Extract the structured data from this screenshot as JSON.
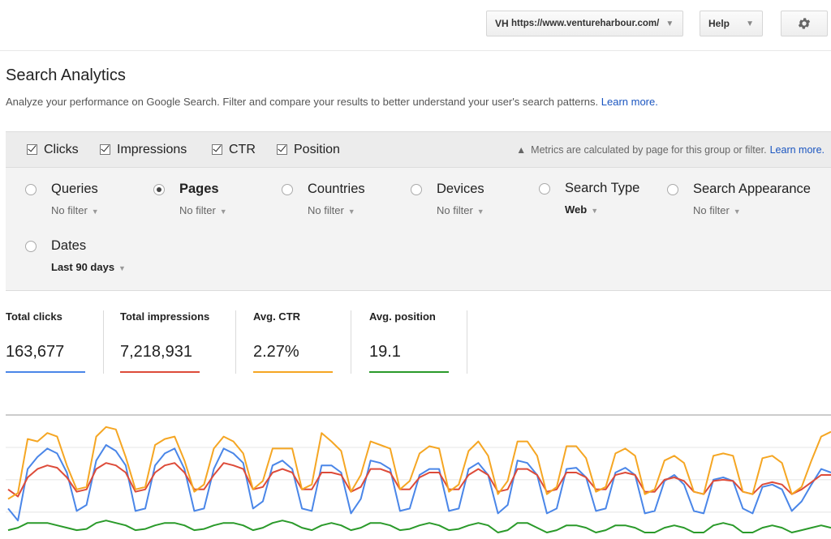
{
  "header": {
    "site_prefix": "VH",
    "site_url": "https://www.ventureharbour.com/",
    "help_label": "Help",
    "settings_icon": "gear-icon"
  },
  "page": {
    "title": "Search Analytics",
    "subtitle": "Analyze your performance on Google Search. Filter and compare your results to better understand your user's search patterns.",
    "learn_more": "Learn more."
  },
  "metrics": {
    "items": [
      {
        "label": "Clicks",
        "checked": true
      },
      {
        "label": "Impressions",
        "checked": true
      },
      {
        "label": "CTR",
        "checked": true
      },
      {
        "label": "Position",
        "checked": true
      }
    ],
    "note": "Metrics are calculated by page for this group or filter.",
    "note_link": "Learn more."
  },
  "filters": [
    {
      "name": "Queries",
      "value": "No filter",
      "selected": false
    },
    {
      "name": "Pages",
      "value": "No filter",
      "selected": true
    },
    {
      "name": "Countries",
      "value": "No filter",
      "selected": false
    },
    {
      "name": "Devices",
      "value": "No filter",
      "selected": false
    },
    {
      "name": "Search Type",
      "value": "Web",
      "selected": false
    },
    {
      "name": "Search Appearance",
      "value": "No filter",
      "selected": false
    },
    {
      "name": "Dates",
      "value": "Last 90 days",
      "selected": false
    }
  ],
  "totals": [
    {
      "label": "Total clicks",
      "value": "163,677",
      "color": "#4a86e8"
    },
    {
      "label": "Total impressions",
      "value": "7,218,931",
      "color": "#dd4b39"
    },
    {
      "label": "Avg. CTR",
      "value": "2.27%",
      "color": "#f5a623"
    },
    {
      "label": "Avg. position",
      "value": "19.1",
      "color": "#2a9a2a"
    }
  ],
  "chart_data": {
    "type": "line",
    "series": [
      {
        "color": "#4a86e8",
        "values": [
          0.22,
          0.12,
          0.55,
          0.65,
          0.72,
          0.68,
          0.52,
          0.2,
          0.25,
          0.62,
          0.75,
          0.7,
          0.58,
          0.2,
          0.22,
          0.58,
          0.68,
          0.72,
          0.55,
          0.2,
          0.22,
          0.55,
          0.72,
          0.68,
          0.6,
          0.22,
          0.28,
          0.58,
          0.62,
          0.55,
          0.22,
          0.2,
          0.58,
          0.58,
          0.52,
          0.18,
          0.3,
          0.62,
          0.6,
          0.55,
          0.2,
          0.22,
          0.5,
          0.55,
          0.55,
          0.2,
          0.22,
          0.55,
          0.6,
          0.5,
          0.18,
          0.25,
          0.62,
          0.6,
          0.5,
          0.18,
          0.22,
          0.55,
          0.56,
          0.48,
          0.2,
          0.22,
          0.52,
          0.56,
          0.5,
          0.18,
          0.2,
          0.45,
          0.5,
          0.42,
          0.2,
          0.18,
          0.46,
          0.48,
          0.45,
          0.22,
          0.18,
          0.4,
          0.42,
          0.38,
          0.2,
          0.28,
          0.42,
          0.55,
          0.52
        ]
      },
      {
        "color": "#dd4b39",
        "values": [
          0.38,
          0.32,
          0.48,
          0.55,
          0.58,
          0.56,
          0.48,
          0.36,
          0.38,
          0.55,
          0.6,
          0.58,
          0.52,
          0.36,
          0.38,
          0.52,
          0.58,
          0.6,
          0.52,
          0.38,
          0.38,
          0.5,
          0.6,
          0.58,
          0.55,
          0.38,
          0.4,
          0.52,
          0.55,
          0.52,
          0.38,
          0.38,
          0.52,
          0.52,
          0.5,
          0.36,
          0.4,
          0.55,
          0.55,
          0.52,
          0.38,
          0.38,
          0.48,
          0.52,
          0.52,
          0.38,
          0.38,
          0.5,
          0.55,
          0.5,
          0.36,
          0.38,
          0.55,
          0.55,
          0.5,
          0.36,
          0.38,
          0.52,
          0.52,
          0.48,
          0.38,
          0.38,
          0.5,
          0.52,
          0.5,
          0.36,
          0.36,
          0.46,
          0.48,
          0.45,
          0.36,
          0.34,
          0.45,
          0.46,
          0.45,
          0.36,
          0.34,
          0.42,
          0.44,
          0.42,
          0.34,
          0.38,
          0.44,
          0.5,
          0.5
        ]
      },
      {
        "color": "#f5a623",
        "values": [
          0.3,
          0.35,
          0.8,
          0.78,
          0.85,
          0.82,
          0.58,
          0.38,
          0.4,
          0.82,
          0.9,
          0.88,
          0.65,
          0.38,
          0.4,
          0.75,
          0.8,
          0.82,
          0.62,
          0.36,
          0.42,
          0.72,
          0.82,
          0.78,
          0.68,
          0.38,
          0.45,
          0.72,
          0.72,
          0.72,
          0.38,
          0.42,
          0.85,
          0.78,
          0.7,
          0.36,
          0.5,
          0.78,
          0.75,
          0.72,
          0.38,
          0.45,
          0.68,
          0.74,
          0.72,
          0.36,
          0.42,
          0.7,
          0.78,
          0.66,
          0.34,
          0.45,
          0.78,
          0.78,
          0.66,
          0.34,
          0.4,
          0.74,
          0.74,
          0.64,
          0.36,
          0.4,
          0.68,
          0.72,
          0.66,
          0.34,
          0.38,
          0.62,
          0.66,
          0.6,
          0.36,
          0.34,
          0.66,
          0.68,
          0.66,
          0.36,
          0.34,
          0.64,
          0.66,
          0.6,
          0.34,
          0.4,
          0.62,
          0.82,
          0.86
        ]
      },
      {
        "color": "#2a9a2a",
        "values": [
          0.04,
          0.06,
          0.1,
          0.1,
          0.1,
          0.08,
          0.06,
          0.04,
          0.05,
          0.1,
          0.12,
          0.1,
          0.08,
          0.04,
          0.05,
          0.08,
          0.1,
          0.1,
          0.08,
          0.04,
          0.05,
          0.08,
          0.1,
          0.1,
          0.08,
          0.04,
          0.06,
          0.1,
          0.12,
          0.1,
          0.06,
          0.04,
          0.08,
          0.1,
          0.08,
          0.04,
          0.06,
          0.1,
          0.1,
          0.08,
          0.04,
          0.05,
          0.08,
          0.1,
          0.08,
          0.04,
          0.05,
          0.08,
          0.1,
          0.08,
          0.02,
          0.04,
          0.1,
          0.1,
          0.06,
          0.02,
          0.04,
          0.08,
          0.08,
          0.06,
          0.02,
          0.04,
          0.08,
          0.08,
          0.06,
          0.02,
          0.02,
          0.06,
          0.08,
          0.06,
          0.02,
          0.02,
          0.08,
          0.1,
          0.08,
          0.02,
          0.02,
          0.06,
          0.08,
          0.06,
          0.02,
          0.04,
          0.06,
          0.08,
          0.06
        ]
      }
    ],
    "grid": true
  }
}
